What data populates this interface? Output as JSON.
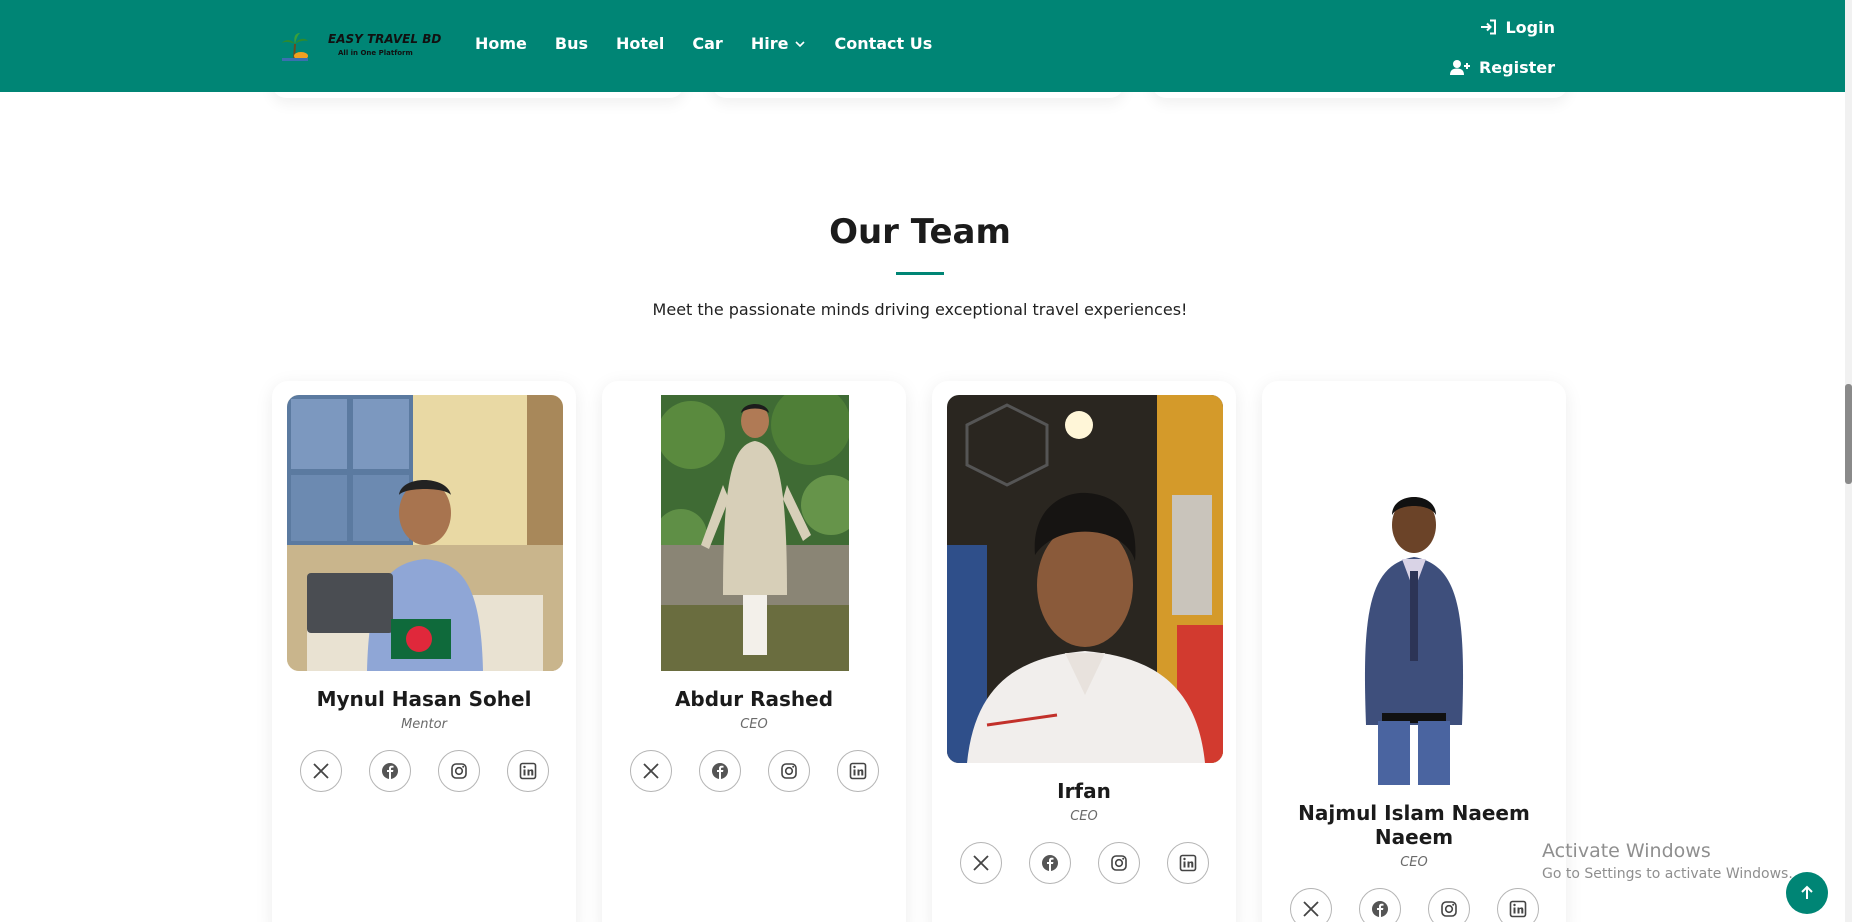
{
  "header": {
    "logo": {
      "title": "EASY TRAVEL BD",
      "tagline": "All in One Platform"
    },
    "nav": [
      {
        "label": "Home"
      },
      {
        "label": "Bus"
      },
      {
        "label": "Hotel"
      },
      {
        "label": "Car"
      },
      {
        "label": "Hire",
        "has_dropdown": true
      },
      {
        "label": "Contact Us"
      }
    ],
    "login_label": "Login",
    "register_label": "Register"
  },
  "team": {
    "title": "Our Team",
    "subtitle": "Meet the passionate minds driving exceptional travel experiences!",
    "members": [
      {
        "name": "Mynul Hasan Sohel",
        "role": "Mentor"
      },
      {
        "name": "Abdur Rashed",
        "role": "CEO"
      },
      {
        "name": "Irfan",
        "role": "CEO"
      },
      {
        "name": "Najmul Islam Naeem Naeem",
        "role": "CEO"
      }
    ],
    "social_icons": [
      "x-icon",
      "facebook-icon",
      "instagram-icon",
      "linkedin-icon"
    ]
  },
  "watermark": {
    "line1": "Activate Windows",
    "line2": "Go to Settings to activate Windows."
  },
  "colors": {
    "brand": "#008575",
    "text": "#1b1b1b",
    "muted": "#6a6a6a"
  }
}
